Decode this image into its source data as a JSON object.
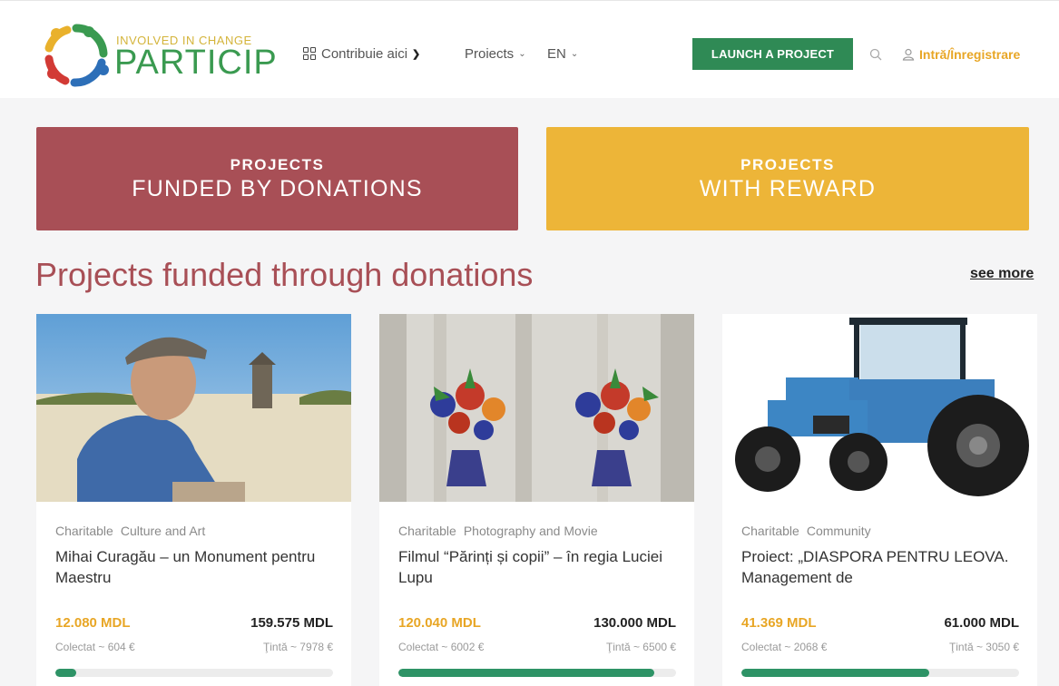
{
  "header": {
    "logo_tagline": "INVOLVED IN CHANGE",
    "logo_name": "PARTICIP",
    "nav": {
      "contribute": "Contribuie aici",
      "projects": "Proiects",
      "language": "EN"
    },
    "launch_button": "LAUNCH A PROJECT",
    "login": "Intră/Înregistrare"
  },
  "banners": [
    {
      "top": "PROJECTS",
      "bottom": "FUNDED BY DONATIONS",
      "color": "#a84f56"
    },
    {
      "top": "PROJECTS",
      "bottom": "WITH REWARD",
      "color": "#edb538"
    }
  ],
  "section": {
    "title": "Projects funded through donations",
    "see_more": "see more"
  },
  "cards": [
    {
      "categories": [
        "Charitable",
        "Culture and Art"
      ],
      "title": "Mihai Curagău – un Monument pentru Maestru",
      "raised": "12.080 MDL",
      "goal": "159.575 MDL",
      "raised_eur": "Colectat ~ 604 €",
      "goal_eur": "Ţintă ~ 7978 €",
      "progress": 0.076
    },
    {
      "categories": [
        "Charitable",
        "Photography and Movie"
      ],
      "title": "Filmul “Părinți și copii” – în regia Luciei Lupu",
      "raised": "120.040 MDL",
      "goal": "130.000 MDL",
      "raised_eur": "Colectat ~ 6002 €",
      "goal_eur": "Ţintă ~ 6500 €",
      "progress": 0.923
    },
    {
      "categories": [
        "Charitable",
        "Community"
      ],
      "title": "Proiect: „DIASPORA PENTRU LEOVA. Management de",
      "raised": "41.369 MDL",
      "goal": "61.000 MDL",
      "raised_eur": "Colectat ~ 2068 €",
      "goal_eur": "Ţintă ~ 3050 €",
      "progress": 0.678
    }
  ],
  "colors": {
    "accent_green": "#2f8a55",
    "accent_orange": "#e8a625",
    "brand_red": "#a84f56",
    "brand_yellow": "#edb538"
  }
}
